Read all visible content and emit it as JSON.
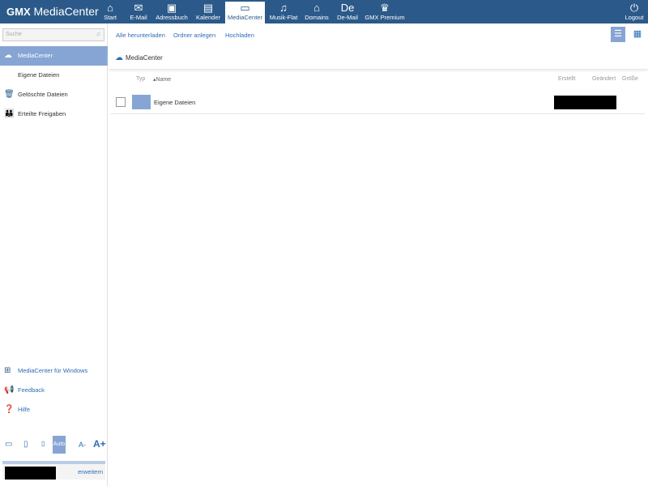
{
  "header": {
    "logo_brand": "GMX",
    "logo_text": "MediaCenter",
    "nav": [
      {
        "label": "Start",
        "icon": "home-icon",
        "glyph": "⌂"
      },
      {
        "label": "E-Mail",
        "icon": "mail-icon",
        "glyph": "✉"
      },
      {
        "label": "Adressbuch",
        "icon": "addressbook-icon",
        "glyph": "▣"
      },
      {
        "label": "Kalender",
        "icon": "calendar-icon",
        "glyph": "▤"
      },
      {
        "label": "MediaCenter",
        "icon": "folder-cloud-icon",
        "glyph": "▭"
      },
      {
        "label": "Musik-Flat",
        "icon": "music-icon",
        "glyph": "♫"
      },
      {
        "label": "Domains",
        "icon": "domain-icon",
        "glyph": "⌂"
      },
      {
        "label": "De-Mail",
        "icon": "demail-icon",
        "glyph": "De"
      },
      {
        "label": "GMX Premium",
        "icon": "crown-icon",
        "glyph": "♛"
      }
    ],
    "logout": "Logout"
  },
  "sidebar": {
    "search_placeholder": "Suche",
    "items": [
      {
        "label": "MediaCenter"
      },
      {
        "label": "Eigene Dateien"
      },
      {
        "label": "Gelöschte Dateien"
      },
      {
        "label": "Erteilte Freigaben"
      }
    ],
    "links": [
      {
        "label": "MediaCenter für Windows"
      },
      {
        "label": "Feedback"
      },
      {
        "label": "Hilfe"
      }
    ],
    "auto_label": "Auto",
    "font_smaller": "A-",
    "font_larger": "A+",
    "expand": "erweitern"
  },
  "toolbar": {
    "download_all": "Alle herunterladen",
    "new_folder": "Ordner anlegen",
    "upload": "Hochladen"
  },
  "breadcrumb": "MediaCenter",
  "table": {
    "headers": {
      "type": "Typ",
      "name": "Name",
      "created": "Erstellt",
      "modified": "Geändert",
      "size": "Größe"
    },
    "rows": [
      {
        "name": "Eigene Dateien"
      }
    ]
  }
}
